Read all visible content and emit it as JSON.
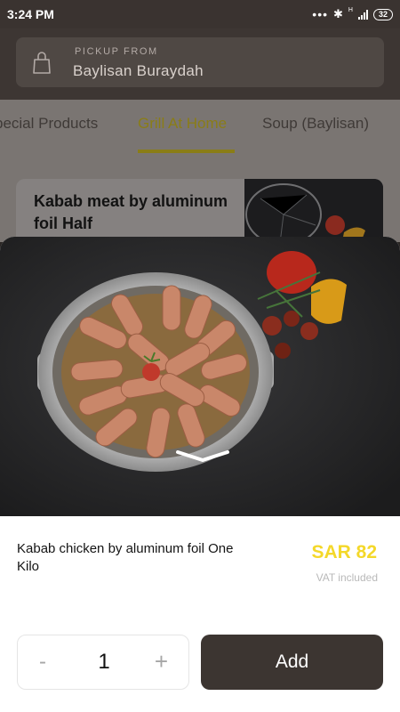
{
  "status_bar": {
    "time": "3:24 PM",
    "network_type": "H",
    "battery": "32"
  },
  "header": {
    "pickup_label": "PICKUP FROM",
    "branch_name": "Baylisan Buraydah"
  },
  "category_tabs": [
    {
      "label": "pecial Products",
      "active": false
    },
    {
      "label": "Grill At Home",
      "active": true
    },
    {
      "label": "Soup (Baylisan)",
      "active": false
    }
  ],
  "background_card": {
    "title": "Kabab meat by aluminum foil Half"
  },
  "product": {
    "name": "Kabab chicken by aluminum foil One Kilo",
    "price": "SAR 82",
    "vat_note": "VAT included"
  },
  "quantity": {
    "minus_label": "-",
    "value": "1",
    "plus_label": "+"
  },
  "actions": {
    "add_label": "Add"
  },
  "colors": {
    "accent_gold": "#f4d82a",
    "tab_active": "#8a7d17",
    "header_bg": "#3d3633",
    "add_button_bg": "#3c3531"
  }
}
